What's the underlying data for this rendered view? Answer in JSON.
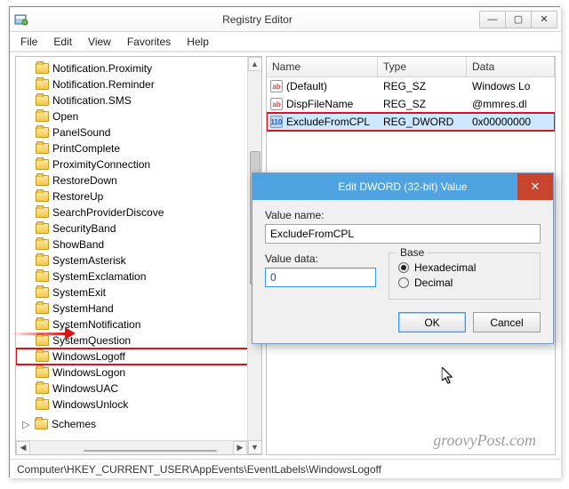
{
  "window": {
    "title": "Registry Editor",
    "menus": [
      "File",
      "Edit",
      "View",
      "Favorites",
      "Help"
    ],
    "buttons": {
      "min": "—",
      "max": "▢",
      "close": "✕"
    }
  },
  "tree": {
    "items": [
      "Notification.Proximity",
      "Notification.Reminder",
      "Notification.SMS",
      "Open",
      "PanelSound",
      "PrintComplete",
      "ProximityConnection",
      "RestoreDown",
      "RestoreUp",
      "SearchProviderDiscove",
      "SecurityBand",
      "ShowBand",
      "SystemAsterisk",
      "SystemExclamation",
      "SystemExit",
      "SystemHand",
      "SystemNotification",
      "SystemQuestion",
      "WindowsLogoff",
      "WindowsLogon",
      "WindowsUAC",
      "WindowsUnlock"
    ],
    "highlighted": "WindowsLogoff",
    "bottomItem": "Schemes"
  },
  "list": {
    "columns": {
      "name": "Name",
      "type": "Type",
      "data": "Data"
    },
    "rows": [
      {
        "icon": "sz",
        "name": "(Default)",
        "type": "REG_SZ",
        "data": "Windows Lo"
      },
      {
        "icon": "sz",
        "name": "DispFileName",
        "type": "REG_SZ",
        "data": "@mmres.dl"
      },
      {
        "icon": "bin",
        "name": "ExcludeFromCPL",
        "type": "REG_DWORD",
        "data": "0x00000000",
        "highlight": true,
        "selected": true
      }
    ]
  },
  "statusbar": "Computer\\HKEY_CURRENT_USER\\AppEvents\\EventLabels\\WindowsLogoff",
  "dialog": {
    "title": "Edit DWORD (32-bit) Value",
    "valueNameLabel": "Value name:",
    "valueName": "ExcludeFromCPL",
    "valueDataLabel": "Value data:",
    "valueData": "0",
    "baseLabel": "Base",
    "radios": {
      "hex": "Hexadecimal",
      "dec": "Decimal"
    },
    "selectedRadio": "hex",
    "ok": "OK",
    "cancel": "Cancel"
  },
  "watermark": "groovyPost.com"
}
